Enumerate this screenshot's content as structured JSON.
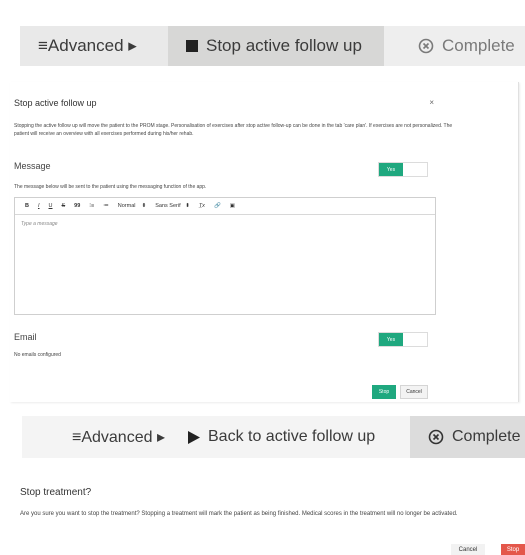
{
  "toolbar_top": {
    "advanced_label": "≡Advanced ▸",
    "stop_label": "Stop active follow up",
    "complete_label": "Complete",
    "stop_icon": "stop-square-icon",
    "complete_icon": "circle-x-icon"
  },
  "modal_stop": {
    "title": "Stop active follow up",
    "close": "×",
    "description": "Stopping the active follow up will move the patient to the PROM stage. Personalisation of exercises after stop active follow-up can be done in the tab 'care plan'. If exercises are not personalized. The patient will receive an overview with all exercises performed during his/her rehab.",
    "message_label": "Message",
    "message_toggle": "Yes",
    "message_note": "The message below will be sent to the patient using the messaging function of the app.",
    "editor_toolbar": {
      "bold": "B",
      "italic": "I",
      "underline": "U",
      "strike": "S",
      "quote": "99",
      "ordered_list": "⁝≡",
      "bullet_list": "≔",
      "heading_select": "Normal",
      "font_select": "Sans Serif",
      "clear_format": "T̲x",
      "link": "🔗",
      "image": "▣",
      "select_arrow": "⬍"
    },
    "editor_placeholder": "Type a message",
    "email_label": "Email",
    "email_toggle": "Yes",
    "email_note": "No emails configured",
    "stop_button": "Stop",
    "cancel_button": "Cancel"
  },
  "toolbar_bottom": {
    "advanced_label": "≡Advanced ▸",
    "back_label": "Back to active follow up",
    "complete_label": "Complete",
    "play_icon": "play-icon",
    "complete_icon": "circle-x-icon"
  },
  "stop_treatment": {
    "title": "Stop treatment?",
    "description": "Are you sure you want to stop the treatment? Stopping a treatment will mark the patient as being finished. Medical scores in the treatment will no longer be activated.",
    "cancel_button": "Cancel",
    "stop_button": "Stop"
  },
  "colors": {
    "accent_green": "#1fa87f",
    "danger_red": "#e4574b",
    "toolbar_grey": "#d7d7d6"
  }
}
